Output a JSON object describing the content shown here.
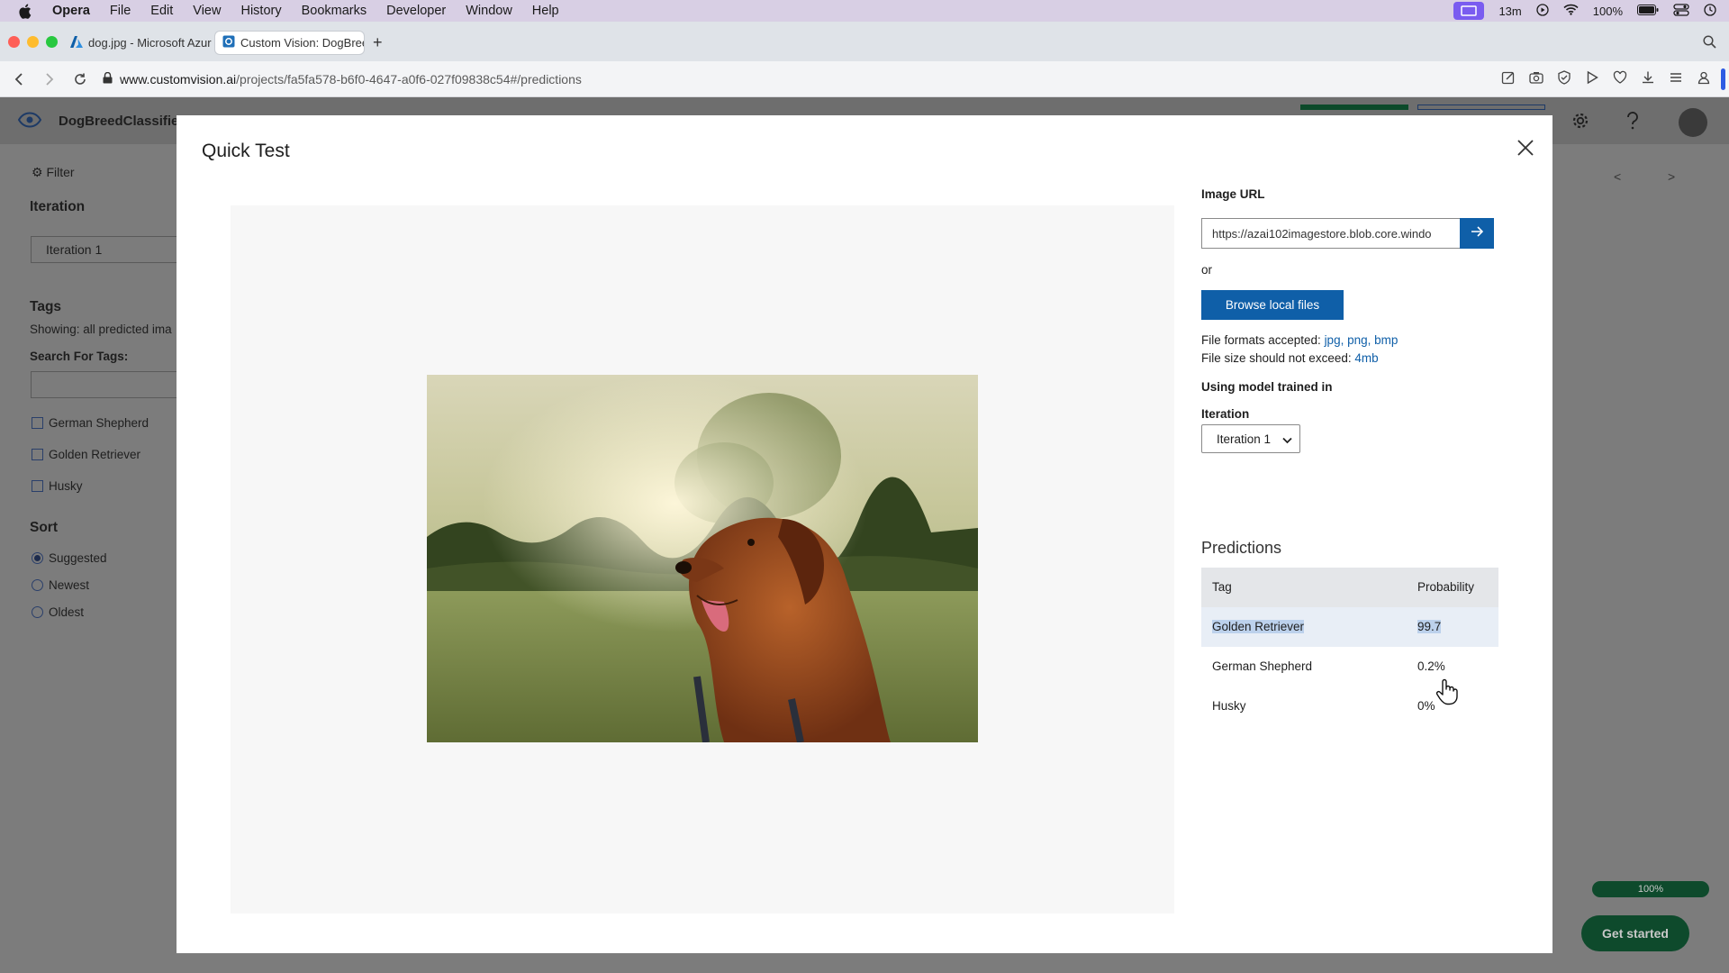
{
  "menubar": {
    "items": [
      "Opera",
      "File",
      "Edit",
      "View",
      "History",
      "Bookmarks",
      "Developer",
      "Window",
      "Help"
    ],
    "time_left": "13m",
    "battery": "100%"
  },
  "browser": {
    "tabs": [
      {
        "title": "dog.jpg - Microsoft Azure"
      },
      {
        "title": "Custom Vision: DogBreedClassifier"
      }
    ],
    "url_host": "www.customvision.ai",
    "url_path": "/projects/fa5fa578-b6f0-4647-a0f6-027f09838c54#/predictions"
  },
  "app": {
    "project_name": "DogBreedClassifier",
    "sidebar": {
      "filter_label": "Filter",
      "iteration_heading": "Iteration",
      "iteration_value": "Iteration 1",
      "tags_heading": "Tags",
      "showing_text": "Showing: all predicted ima",
      "search_label": "Search For Tags:",
      "tags": [
        "German Shepherd",
        "Golden Retriever",
        "Husky"
      ],
      "sort_heading": "Sort",
      "sort_options": [
        "Suggested",
        "Newest",
        "Oldest"
      ],
      "sort_selected": "Suggested"
    },
    "progress_label": "100%",
    "progress_value": 1.0,
    "get_started_label": "Get started"
  },
  "modal": {
    "title": "Quick Test",
    "image_url_label": "Image URL",
    "image_url_value": "https://azai102imagestore.blob.core.windo",
    "or_text": "or",
    "browse_label": "Browse local files",
    "formats_prefix": "File formats accepted: ",
    "formats_value": "jpg, png, bmp",
    "size_prefix": "File size should not exceed: ",
    "size_value": "4mb",
    "model_text": "Using model trained in",
    "iteration_label": "Iteration",
    "iteration_value": "Iteration 1",
    "predictions_title": "Predictions",
    "table_headers": [
      "Tag",
      "Probability"
    ],
    "predictions": [
      {
        "tag": "Golden Retriever",
        "probability": "99.7"
      },
      {
        "tag": "German Shepherd",
        "probability": "0.2%"
      },
      {
        "tag": "Husky",
        "probability": "0%"
      }
    ]
  },
  "colors": {
    "accent_blue": "#0f5fa8",
    "overlay_gray": "#7c7c7c",
    "selection": "#bcd1ec"
  }
}
